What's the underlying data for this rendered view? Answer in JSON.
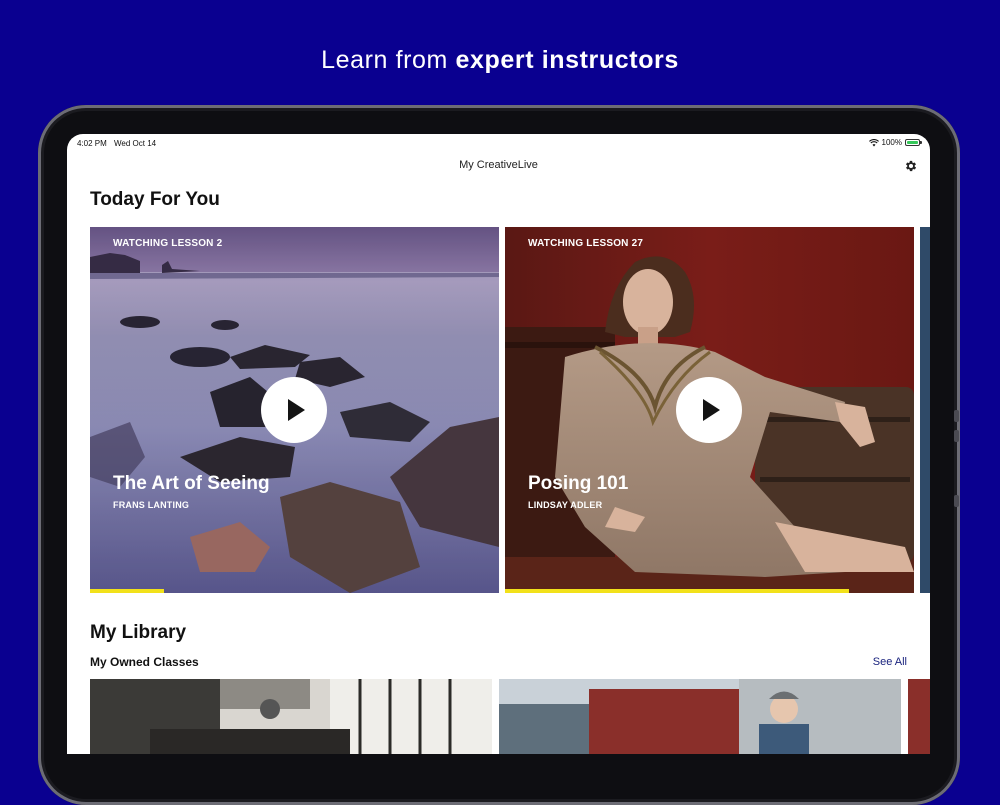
{
  "marketing": {
    "headline_prefix": "Learn from ",
    "headline_bold": "expert instructors"
  },
  "statusbar": {
    "time": "4:02 PM",
    "date": "Wed Oct 14",
    "battery": "100%"
  },
  "nav": {
    "title": "My CreativeLive",
    "settings_icon": "gear-icon"
  },
  "today": {
    "title": "Today For You",
    "cards": [
      {
        "status": "WATCHING LESSON 2",
        "title": "The Art of Seeing",
        "author": "FRANS LANTING",
        "progress": 0.18
      },
      {
        "status": "WATCHING LESSON 27",
        "title": "Posing 101",
        "author": "LINDSAY ADLER",
        "progress": 0.84
      }
    ]
  },
  "library": {
    "title": "My Library",
    "owned_title": "My Owned Classes",
    "see_all": "See All"
  },
  "colors": {
    "background": "#0a0090",
    "progress": "#f2e11a",
    "link": "#1a237e"
  }
}
